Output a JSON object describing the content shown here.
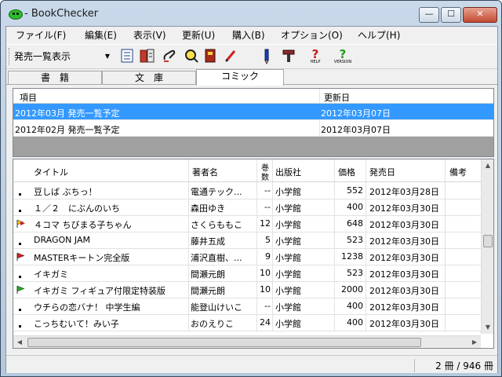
{
  "window": {
    "title": "- BookChecker",
    "min_glyph": "—",
    "max_glyph": "☐",
    "close_glyph": "✕"
  },
  "menu": [
    "ファイル(F)",
    "編集(E)",
    "表示(V)",
    "更新(U)",
    "購入(B)",
    "オプション(O)",
    "ヘルプ(H)"
  ],
  "toolbar": {
    "view_select": "発売一覧表示",
    "buttons": [
      "list-icon",
      "books-icon",
      "link-icon",
      "magnifier-icon",
      "book-red-icon",
      "pencil-red-icon",
      "pencil-blue-icon",
      "hammer-icon",
      "help-icon",
      "version-icon"
    ],
    "help_label": "HELP",
    "version_label": "VERSION"
  },
  "tabs": [
    "書　籍",
    "文　庫",
    "コミック"
  ],
  "active_tab": 2,
  "upper": {
    "headers": [
      "項目",
      "更新日"
    ],
    "rows": [
      {
        "item": "2012年03月 発売一覧予定",
        "updated": "2012年03月07日"
      },
      {
        "item": "2012年02月 発売一覧予定",
        "updated": "2012年03月07日"
      }
    ]
  },
  "lower": {
    "headers": {
      "title": "タイトル",
      "author": "著者名",
      "volumes_1": "巻",
      "volumes_2": "数",
      "publisher": "出版社",
      "price": "価格",
      "date": "発売日",
      "note": "備考"
    },
    "rows": [
      {
        "flag": "none",
        "title": "豆しば ぶちっ！",
        "author": "電通テック...",
        "vol": "--",
        "pub": "小学館",
        "price": "552",
        "date": "2012年03月28日"
      },
      {
        "flag": "none",
        "title": "１／２　にぶんのいち",
        "author": "森田ゆき",
        "vol": "--",
        "pub": "小学館",
        "price": "400",
        "date": "2012年03月30日"
      },
      {
        "flag": "yellow-red",
        "title": "４コマ ちびまる子ちゃん",
        "author": "さくらももこ",
        "vol": "12",
        "pub": "小学館",
        "price": "648",
        "date": "2012年03月30日"
      },
      {
        "flag": "none",
        "title": "DRAGON JAM",
        "author": "藤井五成",
        "vol": "5",
        "pub": "小学館",
        "price": "523",
        "date": "2012年03月30日"
      },
      {
        "flag": "red",
        "title": "MASTERキートン完全版",
        "author": "浦沢直樹、...",
        "vol": "9",
        "pub": "小学館",
        "price": "1238",
        "date": "2012年03月30日"
      },
      {
        "flag": "none",
        "title": "イキガミ",
        "author": "間瀬元朗",
        "vol": "10",
        "pub": "小学館",
        "price": "523",
        "date": "2012年03月30日"
      },
      {
        "flag": "green",
        "title": "イキガミ フィギュア付限定特装版",
        "author": "間瀬元朗",
        "vol": "10",
        "pub": "小学館",
        "price": "2000",
        "date": "2012年03月30日"
      },
      {
        "flag": "none",
        "title": "ウチらの恋バナ！ 中学生編",
        "author": "能登山けいこ",
        "vol": "--",
        "pub": "小学館",
        "price": "400",
        "date": "2012年03月30日"
      },
      {
        "flag": "none",
        "title": "こっちむいて！みい子",
        "author": "おのえりこ",
        "vol": "24",
        "pub": "小学館",
        "price": "400",
        "date": "2012年03月30日"
      }
    ]
  },
  "status": {
    "count": "2 冊 / 946 冊"
  },
  "scroll": {
    "v_up": "▲",
    "v_down": "▼",
    "h_left": "◀",
    "h_right": "▶"
  }
}
